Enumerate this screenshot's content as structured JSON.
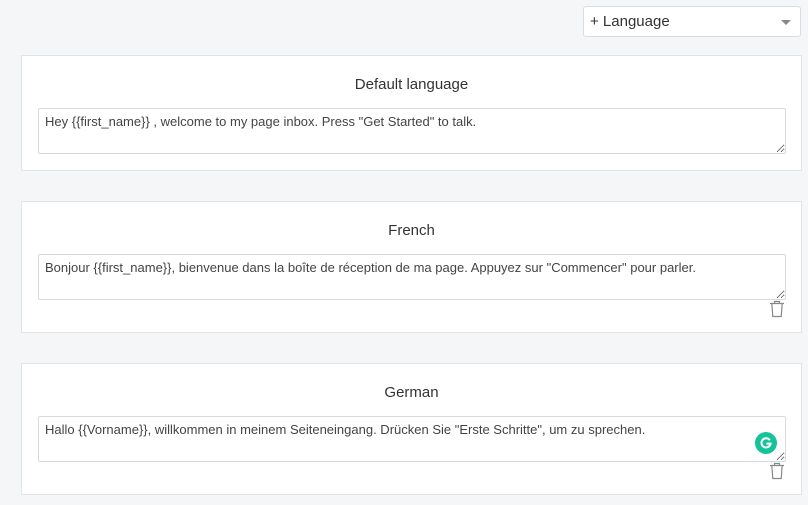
{
  "language_picker": {
    "label": "+ Language"
  },
  "cards": [
    {
      "title": "Default language",
      "message": "Hey {{first_name}} , welcome to my page inbox. Press \"Get Started\" to talk."
    },
    {
      "title": "French",
      "message": "Bonjour {{first_name}}, bienvenue dans la boîte de réception de ma page. Appuyez sur \"Commencer\" pour parler."
    },
    {
      "title": "German",
      "message": "Hallo {{Vorname}}, willkommen in meinem Seiteneingang. Drücken Sie \"Erste Schritte\", um zu sprechen."
    }
  ],
  "icons": {
    "delete": "trash-icon",
    "grammar": "grammarly-icon",
    "dropdown": "chevron-down-icon"
  },
  "colors": {
    "grammarly_badge": "#15c39a"
  }
}
